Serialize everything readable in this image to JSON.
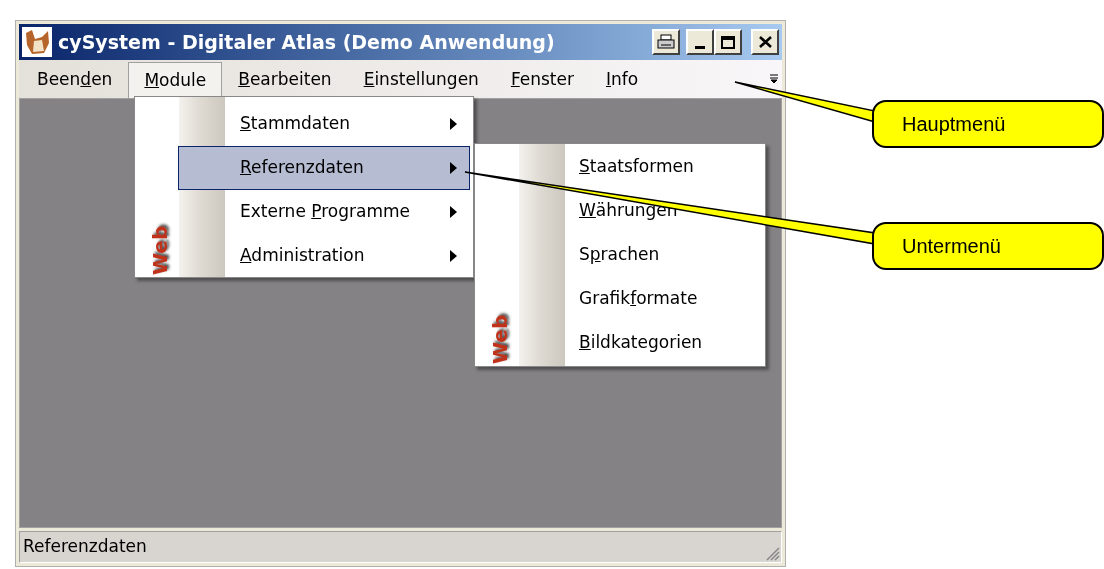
{
  "window": {
    "title": "cySystem - Digitaler Atlas (Demo Anwendung)"
  },
  "menubar": [
    {
      "before": "Been",
      "key": "d",
      "after": "en",
      "selected": false
    },
    {
      "key": "M",
      "after": "odule",
      "selected": true
    },
    {
      "key": "B",
      "after": "earbeiten",
      "selected": false
    },
    {
      "key": "E",
      "after": "instellungen",
      "selected": false
    },
    {
      "key": "F",
      "after": "enster",
      "selected": false
    },
    {
      "key": "I",
      "after": "nfo",
      "selected": false
    }
  ],
  "menu": {
    "side_label": "Web",
    "items": [
      {
        "key": "S",
        "after": "tammdaten",
        "selected": false
      },
      {
        "key": "R",
        "after": "eferenzdaten",
        "selected": true
      },
      {
        "before": "Externe ",
        "key": "P",
        "after": "rogramme",
        "selected": false
      },
      {
        "key": "A",
        "after": "dministration",
        "selected": false
      }
    ]
  },
  "submenu": {
    "side_label": "Web",
    "items": [
      {
        "key": "S",
        "after": "taatsformen"
      },
      {
        "key": "W",
        "after": "ährungen"
      },
      {
        "before": "S",
        "key": "p",
        "after": "rachen"
      },
      {
        "before": "Grafik",
        "key": "f",
        "after": "ormate"
      },
      {
        "key": "B",
        "after": "ildkategorien"
      }
    ]
  },
  "status_bar": {
    "text": "Referenzdaten"
  },
  "callouts": [
    "Hauptmenü",
    "Untermenü"
  ]
}
